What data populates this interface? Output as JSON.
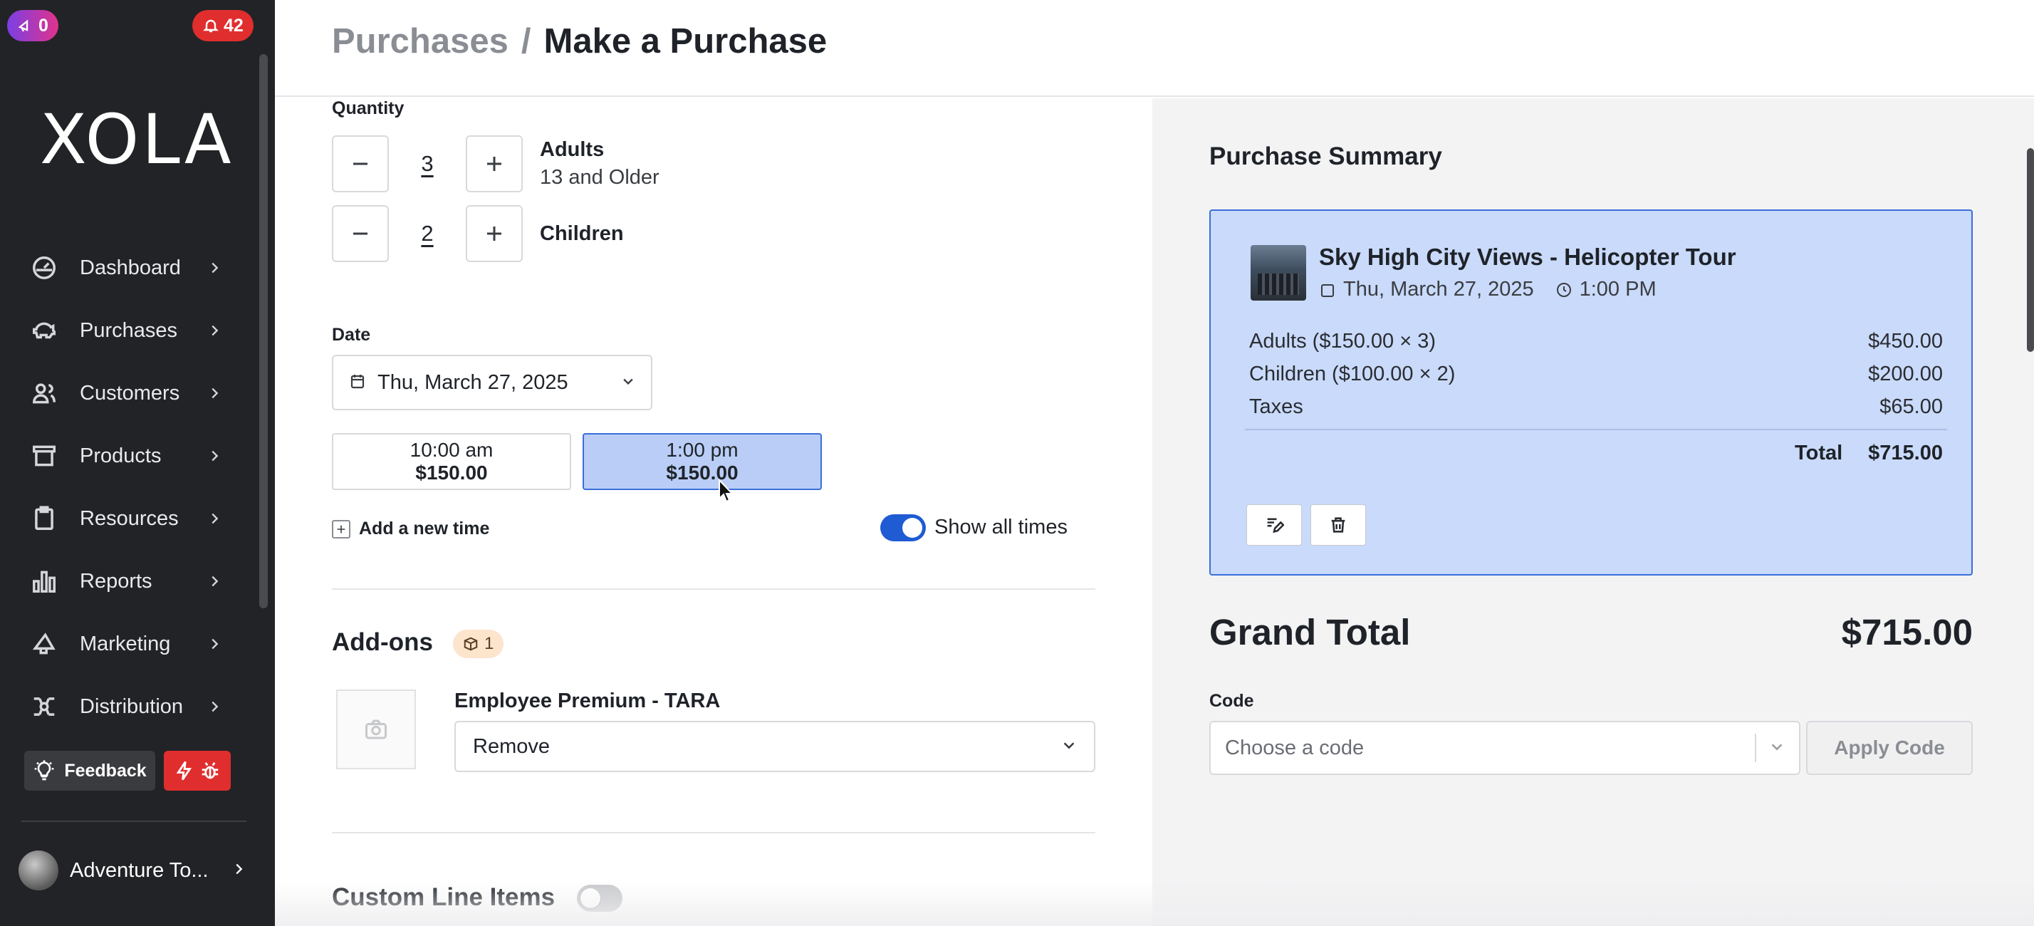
{
  "badges": {
    "notifications_left": "0",
    "notifications_right": "42"
  },
  "sidebar": {
    "logo": "XOLA",
    "items": [
      {
        "label": "Dashboard",
        "icon": "dashboard-icon"
      },
      {
        "label": "Purchases",
        "icon": "piggy-bank-icon"
      },
      {
        "label": "Customers",
        "icon": "users-icon"
      },
      {
        "label": "Products",
        "icon": "archive-box-icon"
      },
      {
        "label": "Resources",
        "icon": "clipboard-icon"
      },
      {
        "label": "Reports",
        "icon": "bar-chart-icon"
      },
      {
        "label": "Marketing",
        "icon": "megaphone-icon"
      },
      {
        "label": "Distribution",
        "icon": "distribution-icon"
      }
    ],
    "feedback_label": "Feedback",
    "account_name": "Adventure To..."
  },
  "header": {
    "crumb_parent": "Purchases",
    "separator": "/",
    "crumb_current": "Make a Purchase"
  },
  "form": {
    "quantity_label": "Quantity",
    "quantities": [
      {
        "value": "3",
        "name": "Adults",
        "desc": "13 and Older"
      },
      {
        "value": "2",
        "name": "Children",
        "desc": ""
      }
    ],
    "date_label": "Date",
    "date_value": "Thu, March 27, 2025",
    "time_slots": [
      {
        "time": "10:00 am",
        "price": "$150.00",
        "selected": false
      },
      {
        "time": "1:00 pm",
        "price": "$150.00",
        "selected": true
      }
    ],
    "add_time_label": "Add a new time",
    "show_all_times_label": "Show all times",
    "show_all_times_on": true,
    "addons_title": "Add-ons",
    "addons_count": "1",
    "addon_name": "Employee Premium - TARA",
    "addon_value": "Remove",
    "custom_line_items_title": "Custom Line Items",
    "custom_line_items_on": false
  },
  "summary": {
    "title": "Purchase Summary",
    "product_title": "Sky High City Views - Helicopter Tour",
    "date": "Thu, March 27, 2025",
    "time": "1:00 PM",
    "lines": [
      {
        "label": "Adults ($150.00 × 3)",
        "amount": "$450.00"
      },
      {
        "label": "Children ($100.00 × 2)",
        "amount": "$200.00"
      },
      {
        "label": "Taxes",
        "amount": "$65.00"
      }
    ],
    "total_label": "Total",
    "total_value": "$715.00",
    "grand_total_label": "Grand Total",
    "grand_total_value": "$715.00",
    "code_label": "Code",
    "code_placeholder": "Choose a code",
    "apply_label": "Apply Code"
  },
  "colors": {
    "accent": "#1f5bd3",
    "selected_bg": "#b9cdf6",
    "card_bg": "#c9dafa",
    "sidebar_bg": "#222326",
    "alert_red": "#e02e2e"
  }
}
